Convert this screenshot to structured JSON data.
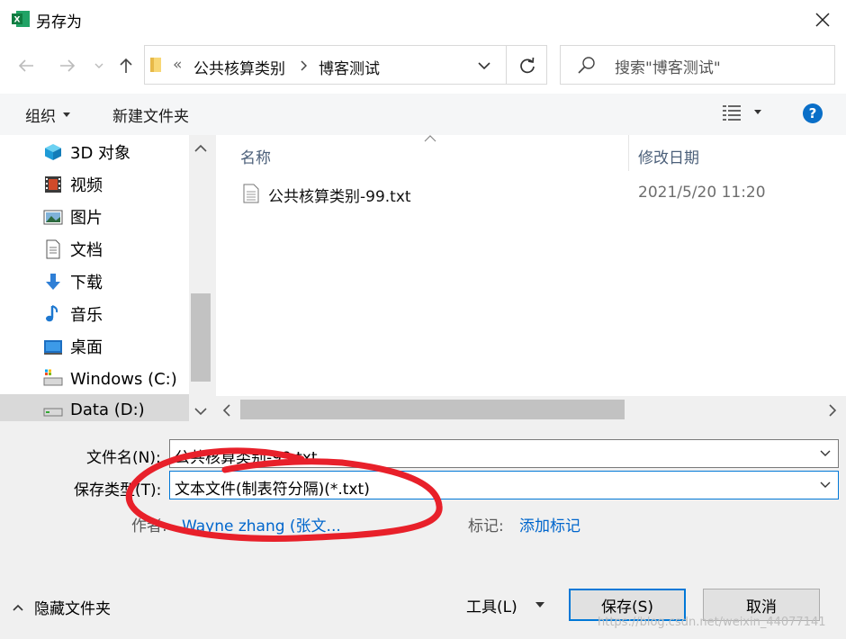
{
  "window": {
    "title": "另存为",
    "app_icon": "excel-icon"
  },
  "nav": {
    "breadcrumb_sep": "«",
    "crumbs": [
      "公共核算类别",
      "博客测试"
    ],
    "search_placeholder": "搜索\"博客测试\""
  },
  "toolbar": {
    "organize_label": "组织",
    "new_folder_label": "新建文件夹"
  },
  "sidebar": {
    "items": [
      {
        "label": "3D 对象",
        "icon": "3d-objects-icon"
      },
      {
        "label": "视频",
        "icon": "video-icon"
      },
      {
        "label": "图片",
        "icon": "pictures-icon"
      },
      {
        "label": "文档",
        "icon": "documents-icon"
      },
      {
        "label": "下载",
        "icon": "download-icon"
      },
      {
        "label": "音乐",
        "icon": "music-icon"
      },
      {
        "label": "桌面",
        "icon": "desktop-icon"
      },
      {
        "label": "Windows (C:)",
        "icon": "drive-icon"
      },
      {
        "label": "Data (D:)",
        "icon": "drive-icon"
      }
    ]
  },
  "files": {
    "columns": [
      "名称",
      "修改日期"
    ],
    "rows": [
      {
        "name": "公共核算类别-99.txt",
        "modified": "2021/5/20 11:20"
      }
    ]
  },
  "form": {
    "filename_label": "文件名(N):",
    "filename_value": "公共核算类别-99.txt",
    "type_label": "保存类型(T):",
    "type_value": "文本文件(制表符分隔)(*.txt)",
    "author_label": "作者:",
    "author_value": "Wayne zhang (张文...",
    "tags_label": "标记:",
    "tags_value": "添加标记"
  },
  "footer": {
    "hide_folders_label": "隐藏文件夹",
    "tools_label": "工具(L)",
    "save_label": "保存(S)",
    "cancel_label": "取消",
    "watermark": "https://blog.csdn.net/weixin_44077141"
  },
  "colors": {
    "accent": "#0078d7",
    "annotation": "#e8202a"
  }
}
